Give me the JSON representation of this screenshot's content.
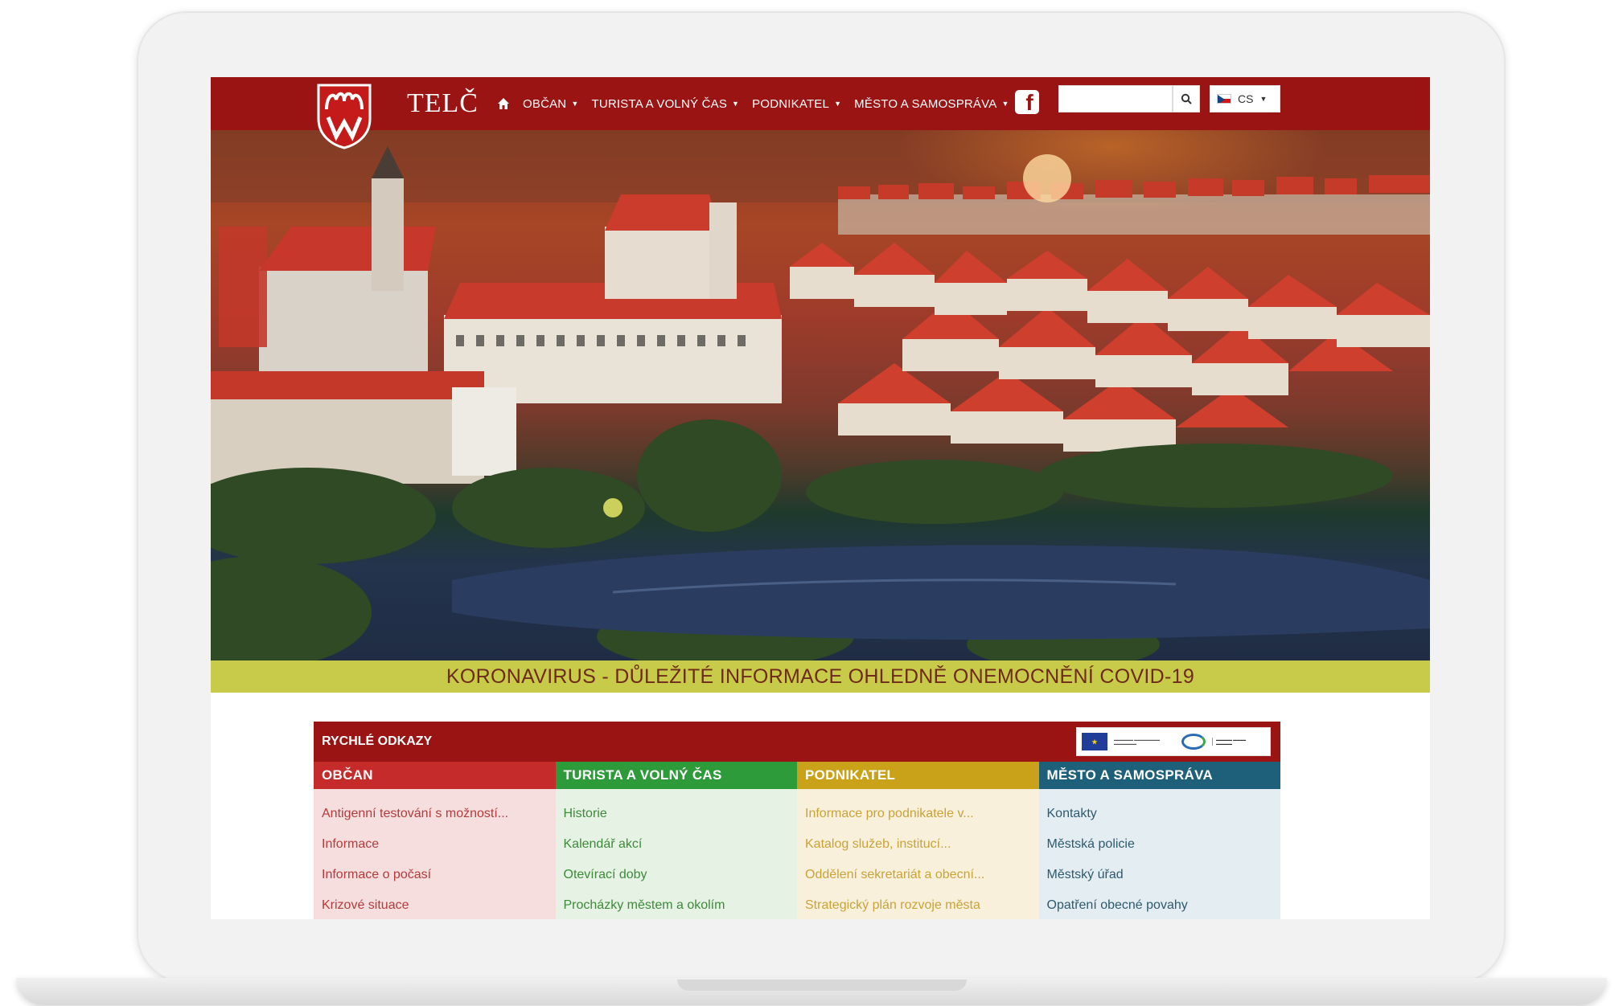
{
  "header": {
    "brand": "TELČ",
    "nav": [
      {
        "label": "OBČAN"
      },
      {
        "label": "TURISTA A VOLNÝ ČAS"
      },
      {
        "label": "PODNIKATEL"
      },
      {
        "label": "MĚSTO A SAMOSPRÁVA"
      }
    ],
    "search_value": "",
    "language": "CS"
  },
  "covid_banner": "KORONAVIRUS - DŮLEŽITÉ INFORMACE OHLEDNĚ ONEMOCNĚNÍ COVID-19",
  "quick_links": {
    "title": "RYCHLÉ ODKAZY",
    "columns": [
      {
        "title": "OBČAN",
        "header_color": "#c62b2b",
        "bg_color": "#f7dede",
        "text_color": "#b33b3b",
        "links": [
          "Antigenní testování s možností...",
          "Informace",
          "Informace o počasí",
          "Krizové situace"
        ]
      },
      {
        "title": "TURISTA A VOLNÝ ČAS",
        "header_color": "#2e9b3a",
        "bg_color": "#e6f2e4",
        "text_color": "#3d8a3a",
        "links": [
          "Historie",
          "Kalendář akcí",
          "Otevírací doby",
          "Procházky městem a okolím"
        ]
      },
      {
        "title": "PODNIKATEL",
        "header_color": "#c9a21a",
        "bg_color": "#f8f0da",
        "text_color": "#c9a23a",
        "links": [
          "Informace pro podnikatele v...",
          "Katalog služeb, institucí...",
          "Oddělení sekretariát a obecní...",
          "Strategický plán rozvoje města"
        ]
      },
      {
        "title": "MĚSTO A SAMOSPRÁVA",
        "header_color": "#1e5f7a",
        "bg_color": "#e4edf2",
        "text_color": "#2e5a6e",
        "links": [
          "Kontakty",
          "Městská policie",
          "Městský úřad",
          "Opatření obecné povahy"
        ]
      }
    ]
  },
  "colors": {
    "header": "#9b1414",
    "covid_banner": "#c8cb4a"
  }
}
